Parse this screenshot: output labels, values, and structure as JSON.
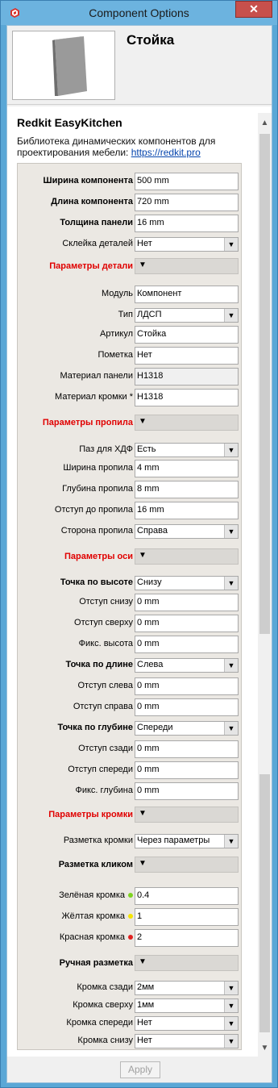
{
  "window": {
    "title": "Component Options",
    "close_glyph": "✕"
  },
  "header": {
    "component_name": "Стойка"
  },
  "info": {
    "brand": "Redkit EasyKitchen",
    "description": "Библиотека динамических компонентов для проектирования мебели: ",
    "link_text": "https://redkit.pro"
  },
  "rows": [
    {
      "label": "Ширина компонента",
      "bold": true,
      "kind": "input",
      "value": "500 mm"
    },
    {
      "label": "Длина компонента",
      "bold": true,
      "kind": "input",
      "value": "720 mm"
    },
    {
      "label": "Толщина панели",
      "bold": true,
      "kind": "input",
      "value": "16 mm"
    },
    {
      "label": "Склейка деталей",
      "kind": "select",
      "value": "Нет"
    },
    {
      "label": "Параметры детали",
      "kind": "section",
      "value": "▼"
    },
    {
      "label": "Модуль",
      "kind": "input",
      "value": "Компонент"
    },
    {
      "label": "Тип",
      "kind": "select",
      "value": "ЛДСП"
    },
    {
      "label": "Артикул",
      "kind": "input",
      "value": "Стойка"
    },
    {
      "label": "Пометка",
      "kind": "input",
      "value": "Нет"
    },
    {
      "label": "Материал панели",
      "kind": "readonly",
      "value": "H1318"
    },
    {
      "label": "Материал кромки *",
      "kind": "input",
      "value": "H1318"
    },
    {
      "label": "Параметры пропила",
      "kind": "section",
      "value": "▼"
    },
    {
      "label": "Паз для ХДФ",
      "kind": "select",
      "value": "Есть"
    },
    {
      "label": "Ширина пропила",
      "kind": "input",
      "value": "4 mm"
    },
    {
      "label": "Глубина пропила",
      "kind": "input",
      "value": "8 mm"
    },
    {
      "label": "Отступ до пропила",
      "kind": "input",
      "value": "16 mm"
    },
    {
      "label": "Сторона пропила",
      "kind": "select",
      "value": "Справа"
    },
    {
      "label": "Параметры оси",
      "kind": "section",
      "value": "▼"
    },
    {
      "label": "Точка по высоте",
      "bold": true,
      "kind": "select",
      "value": "Снизу"
    },
    {
      "label": "Отступ снизу",
      "kind": "input",
      "value": "0 mm"
    },
    {
      "label": "Отступ сверху",
      "kind": "input",
      "value": "0 mm"
    },
    {
      "label": "Фикс. высота",
      "kind": "input",
      "value": "0 mm"
    },
    {
      "label": "Точка по длине",
      "bold": true,
      "kind": "select",
      "value": "Слева"
    },
    {
      "label": "Отступ слева",
      "kind": "input",
      "value": "0 mm"
    },
    {
      "label": "Отступ справа",
      "kind": "input",
      "value": "0 mm"
    },
    {
      "label": "Точка по глубине",
      "bold": true,
      "kind": "select",
      "value": "Спереди"
    },
    {
      "label": "Отступ сзади",
      "kind": "input",
      "value": "0 mm"
    },
    {
      "label": "Отступ спереди",
      "kind": "input",
      "value": "0 mm"
    },
    {
      "label": "Фикс. глубина",
      "kind": "input",
      "value": "0 mm"
    },
    {
      "label": "Параметры кромки",
      "kind": "section",
      "value": "▼"
    },
    {
      "label": "Разметка кромки",
      "kind": "select",
      "value": "Через параметры"
    },
    {
      "label": "Разметка кликом",
      "bold": true,
      "kind": "toggle",
      "value": "▼"
    },
    {
      "label": "Зелёная кромка",
      "kind": "input",
      "value": "0.4",
      "dot": "#7ed321"
    },
    {
      "label": "Жёлтая кромка",
      "kind": "input",
      "value": "1",
      "dot": "#f5e400"
    },
    {
      "label": "Красная кромка",
      "kind": "input",
      "value": "2",
      "dot": "#e02020"
    },
    {
      "label": "Ручная разметка",
      "bold": true,
      "kind": "toggle",
      "value": "▼"
    },
    {
      "label": "Кромка сзади",
      "kind": "select",
      "value": "2мм"
    },
    {
      "label": "Кромка сверху",
      "kind": "select",
      "value": "1мм"
    },
    {
      "label": "Кромка спереди",
      "kind": "select",
      "value": "Нет"
    },
    {
      "label": "Кромка снизу",
      "kind": "select",
      "value": "Нет"
    }
  ],
  "footer": {
    "apply_label": "Apply"
  },
  "colors": {
    "section_label": "#e00000",
    "titlebar": "#6cb3df",
    "close": "#c7504c"
  }
}
